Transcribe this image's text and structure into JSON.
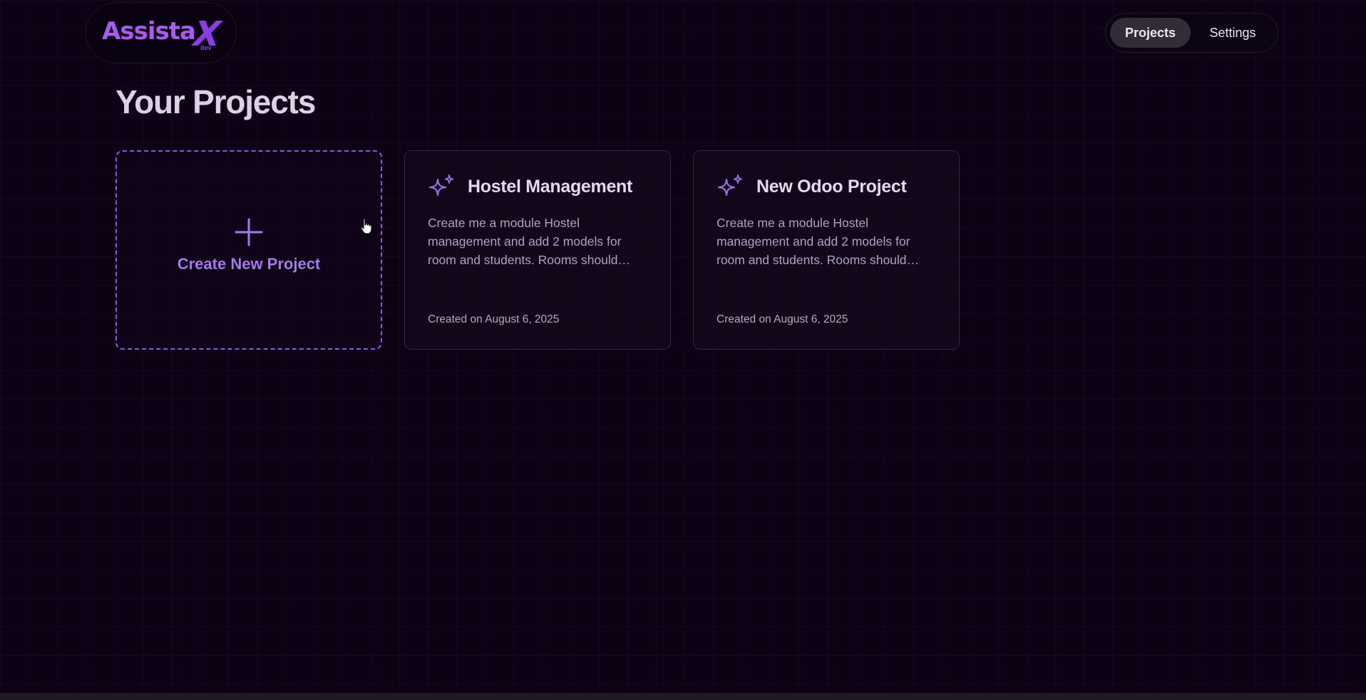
{
  "logo": {
    "text": "Assista",
    "x_letter": "X",
    "sub": "dev"
  },
  "nav": {
    "items": [
      {
        "label": "Projects",
        "active": true
      },
      {
        "label": "Settings",
        "active": false
      }
    ]
  },
  "page": {
    "title": "Your Projects"
  },
  "create_card": {
    "label": "Create New Project",
    "icon": "plus-icon"
  },
  "projects": [
    {
      "title": "Hostel Management",
      "description": "Create me a module Hostel management and add 2 models for room and students. Rooms should…",
      "created": "Created on August 6, 2025",
      "icon": "sparkles-icon"
    },
    {
      "title": "New Odoo Project",
      "description": "Create me a module Hostel management and add 2 models for room and students. Rooms should…",
      "created": "Created on August 6, 2025",
      "icon": "sparkles-icon"
    }
  ],
  "colors": {
    "accent": "#8c55e6",
    "background": "#0d0214",
    "title": "#dccfe6"
  }
}
